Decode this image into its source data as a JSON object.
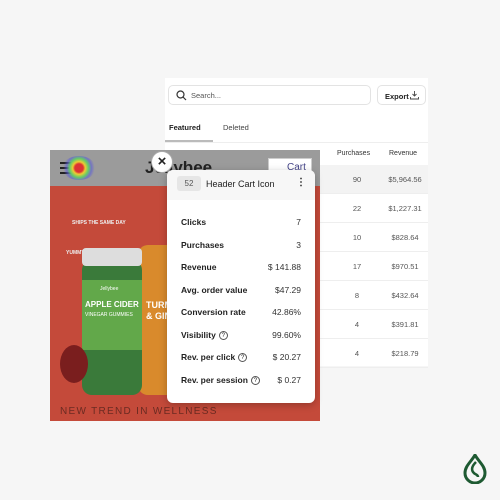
{
  "search": {
    "placeholder": "Search..."
  },
  "toolbar": {
    "export_label": "Export"
  },
  "tabs": [
    {
      "label": "Featured",
      "active": true
    },
    {
      "label": "Deleted",
      "active": false
    }
  ],
  "table": {
    "columns": [
      "Purchases",
      "Revenue"
    ],
    "rows": [
      [
        "90",
        "$5,964.56"
      ],
      [
        "22",
        "$1,227.31"
      ],
      [
        "10",
        "$828.64"
      ],
      [
        "17",
        "$970.51"
      ],
      [
        "8",
        "$432.64"
      ],
      [
        "4",
        "$391.81"
      ],
      [
        "4",
        "$218.79"
      ]
    ]
  },
  "screenshot": {
    "logo": "Jellybee",
    "cart_label": "Cart",
    "handwriting": [
      "SHIPS THE SAME DAY",
      "YUMMY"
    ],
    "product_labels": [
      "Jellybee",
      "APPLE CIDER",
      "VINEGAR GUMMIES",
      "TURMERIC",
      "& GINGER"
    ],
    "tagline": "NEW TREND IN WELLNESS"
  },
  "popup": {
    "id": "52",
    "title": "Header Cart Icon",
    "stats": [
      {
        "label": "Clicks",
        "value": "7"
      },
      {
        "label": "Purchases",
        "value": "3"
      },
      {
        "label": "Revenue",
        "value": "$ 141.88"
      },
      {
        "label": "Avg. order value",
        "value": "$47.29"
      },
      {
        "label": "Conversion rate",
        "value": "42.86%"
      },
      {
        "label": "Visibility",
        "value": "99.60%",
        "help": true
      },
      {
        "label": "Rev. per click",
        "value": "$ 20.27",
        "help": true
      },
      {
        "label": "Rev. per session",
        "value": "$ 0.27",
        "help": true
      }
    ]
  },
  "colors": {
    "brand": "#1e5a32",
    "heat_overlay": "#c44a3a"
  }
}
